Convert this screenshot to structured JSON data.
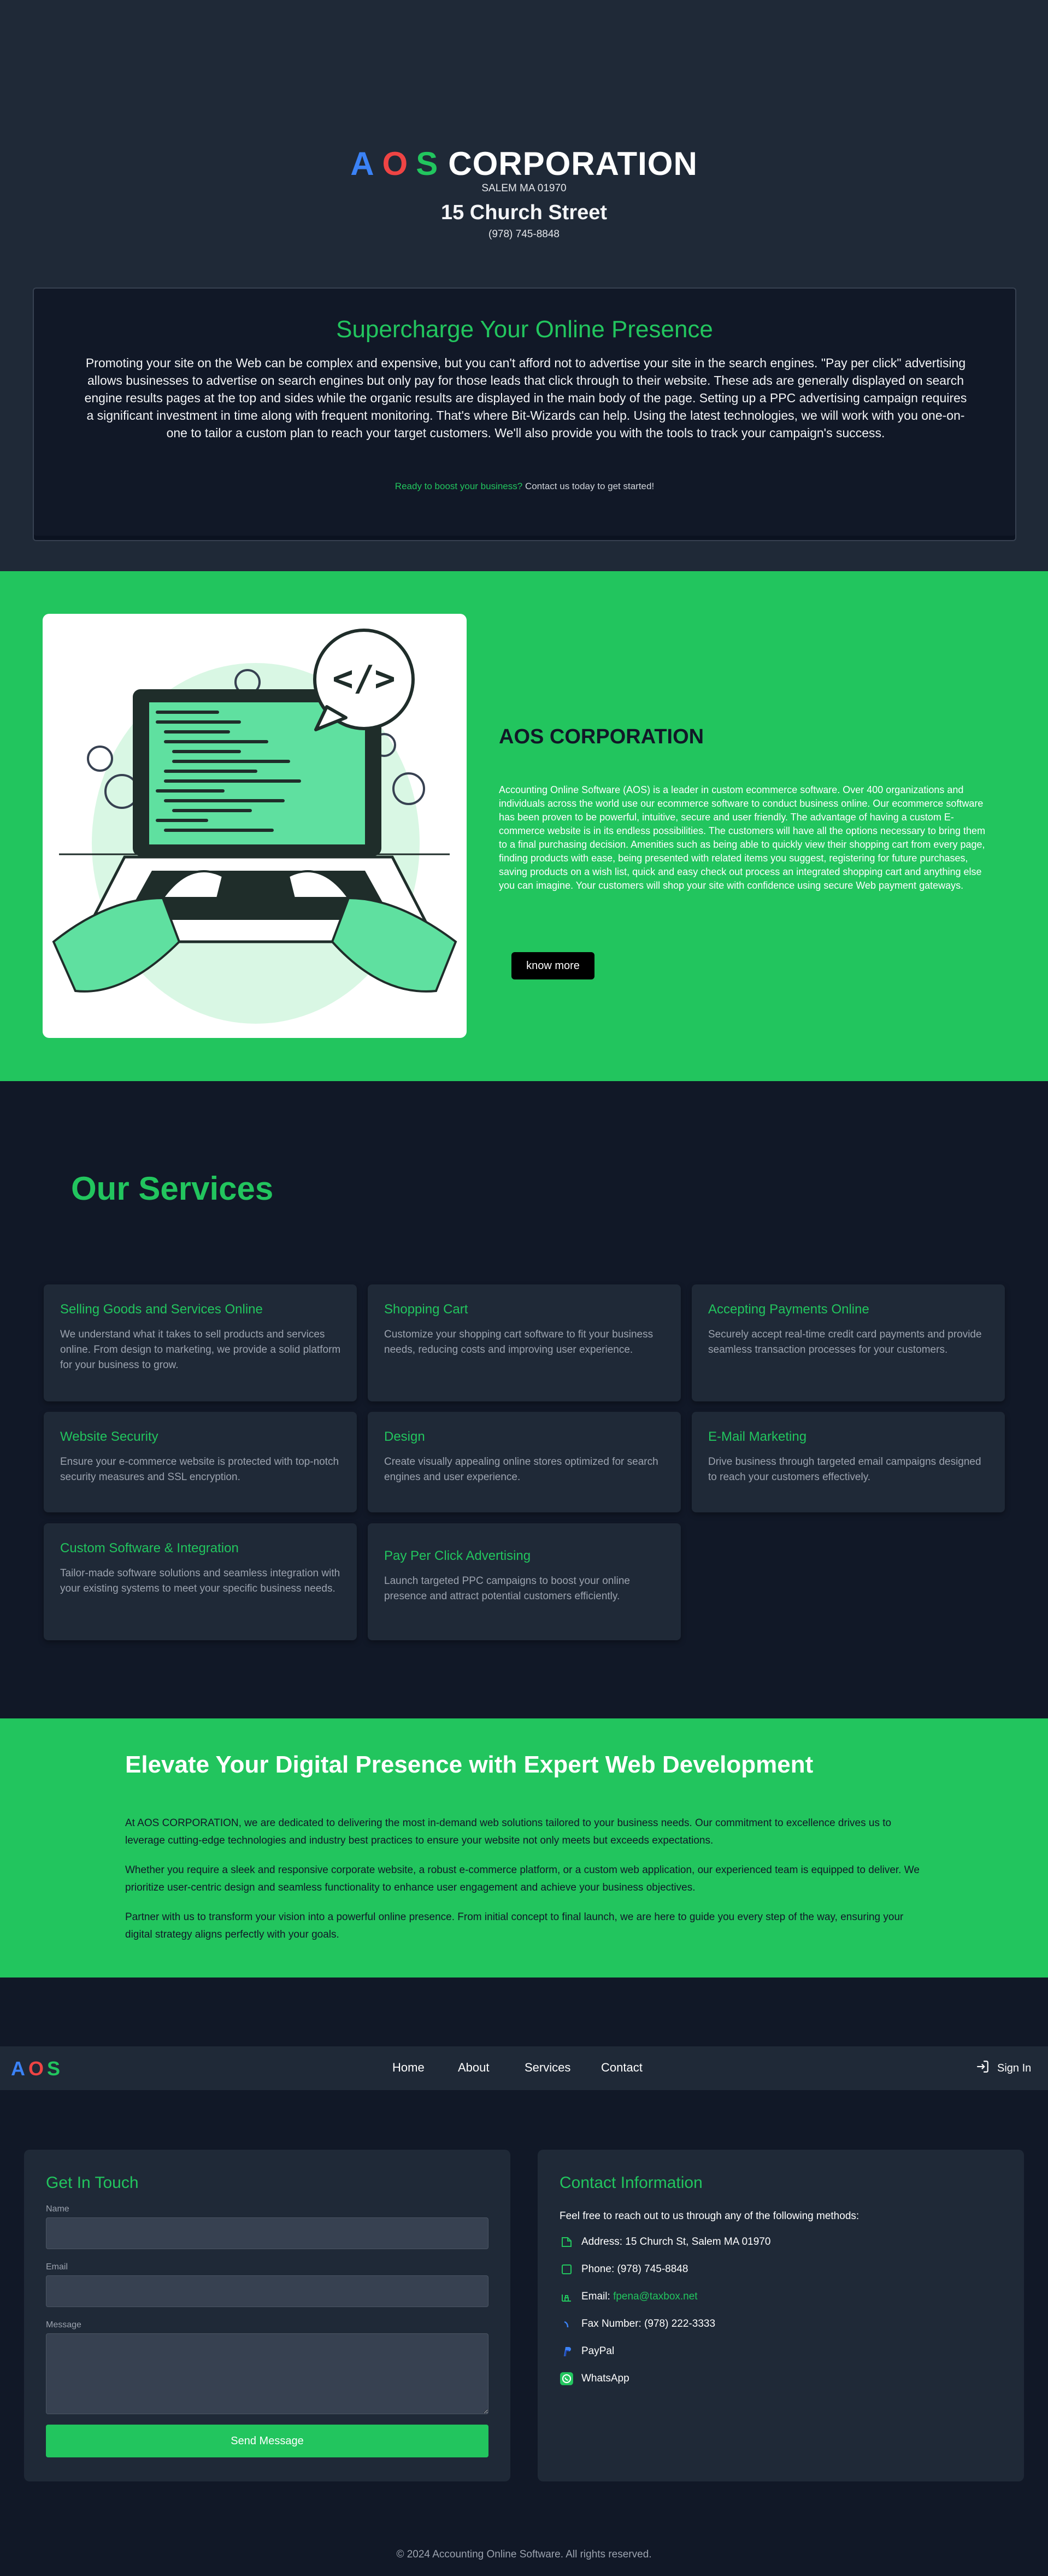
{
  "hero": {
    "brand_letters": [
      "A",
      "O",
      "S"
    ],
    "brand_word": "CORPORATION",
    "city_line": "SALEM MA 01970",
    "street": "15 Church Street",
    "phone": "(978) 745-8848"
  },
  "promo": {
    "title": "Supercharge Your Online Presence",
    "body": "Promoting your site on the Web can be complex and expensive, but you can't afford not to advertise your site in the search engines. \"Pay per click\" advertising allows businesses to advertise on search engines but only pay for those leads that click through to their website. These ads are generally displayed on search engine results pages at the top and sides while the organic results are displayed in the main body of the page. Setting up a PPC advertising campaign requires a significant investment in time along with frequent monitoring. That's where Bit-Wizards can help. Using the latest technologies, we will work with you one-on-one to tailor a custom plan to reach your target customers. We'll also provide you with the tools to track your campaign's success.",
    "cta_highlight": "Ready to boost your business?",
    "cta_rest": " Contact us today to get started!"
  },
  "about": {
    "title": "AOS CORPORATION",
    "body": "Accounting Online Software (AOS) is a leader in custom ecommerce software. Over 400 organizations and individuals across the world use our ecommerce software to conduct business online. Our ecommerce software has been proven to be powerful, intuitive, secure and user friendly. The advantage of having a custom E-commerce website is in its endless possibilities. The customers will have all the options necessary to bring them to a final purchasing decision. Amenities such as being able to quickly view their shopping cart from every page, finding products with ease, being presented with related items you suggest, registering for future purchases, saving products on a wish list, quick and easy check out process an integrated shopping cart and anything else you can imagine. Your customers will shop your site with confidence using secure Web payment gateways.",
    "button": "know more",
    "illustration_glyph": "</>"
  },
  "services": {
    "title": "Our Services",
    "items": [
      {
        "title": "Selling Goods and Services Online",
        "desc": "We understand what it takes to sell products and services online. From design to marketing, we provide a solid platform for your business to grow."
      },
      {
        "title": "Shopping Cart",
        "desc": "Customize your shopping cart software to fit your business needs, reducing costs and improving user experience."
      },
      {
        "title": "Accepting Payments Online",
        "desc": "Securely accept real-time credit card payments and provide seamless transaction processes for your customers."
      },
      {
        "title": "Website Security",
        "desc": "Ensure your e-commerce website is protected with top-notch security measures and SSL encryption."
      },
      {
        "title": "Design",
        "desc": "Create visually appealing online stores optimized for search engines and user experience."
      },
      {
        "title": "E-Mail Marketing",
        "desc": "Drive business through targeted email campaigns designed to reach your customers effectively."
      },
      {
        "title": "Custom Software & Integration",
        "desc": "Tailor-made software solutions and seamless integration with your existing systems to meet your specific business needs."
      },
      {
        "title": "Pay Per Click Advertising",
        "desc": "Launch targeted PPC campaigns to boost your online presence and attract potential customers efficiently."
      }
    ]
  },
  "elevate": {
    "title": "Elevate Your Digital Presence with Expert Web Development",
    "paragraphs": [
      "At AOS CORPORATION, we are dedicated to delivering the most in-demand web solutions tailored to your business needs. Our commitment to excellence drives us to leverage cutting-edge technologies and industry best practices to ensure your website not only meets but exceeds expectations.",
      "Whether you require a sleek and responsive corporate website, a robust e-commerce platform, or a custom web application, our experienced team is equipped to deliver. We prioritize user-centric design and seamless functionality to enhance user engagement and achieve your business objectives.",
      "Partner with us to transform your vision into a powerful online presence. From initial concept to final launch, we are here to guide you every step of the way, ensuring your digital strategy aligns perfectly with your goals."
    ]
  },
  "nav": {
    "logo_letters": [
      "A",
      "O",
      "S"
    ],
    "links": [
      "Home",
      "About",
      "Services",
      "Contact"
    ],
    "sign_in": "Sign In"
  },
  "form": {
    "title": "Get In Touch",
    "name_label": "Name",
    "name_value": "",
    "email_label": "Email",
    "email_value": "",
    "message_label": "Message",
    "message_value": "",
    "submit": "Send Message"
  },
  "contact": {
    "title": "Contact Information",
    "intro": "Feel free to reach out to us through any of the following methods:",
    "address": "Address: 15 Church St, Salem MA 01970",
    "phone": "Phone: (978) 745-8848",
    "email_label": "Email: ",
    "email_value": "fpena@taxbox.net",
    "fax": "Fax Number: (978) 222-3333",
    "paypal": "PayPal",
    "whatsapp": "WhatsApp"
  },
  "footer": {
    "text": "© 2024 Accounting Online Software. All rights reserved."
  },
  "colors": {
    "accent_green": "#22c55e",
    "brand_blue": "#3b82f6",
    "brand_red": "#ef4444",
    "dark_bg": "#111827",
    "panel_bg": "#1f2937"
  }
}
